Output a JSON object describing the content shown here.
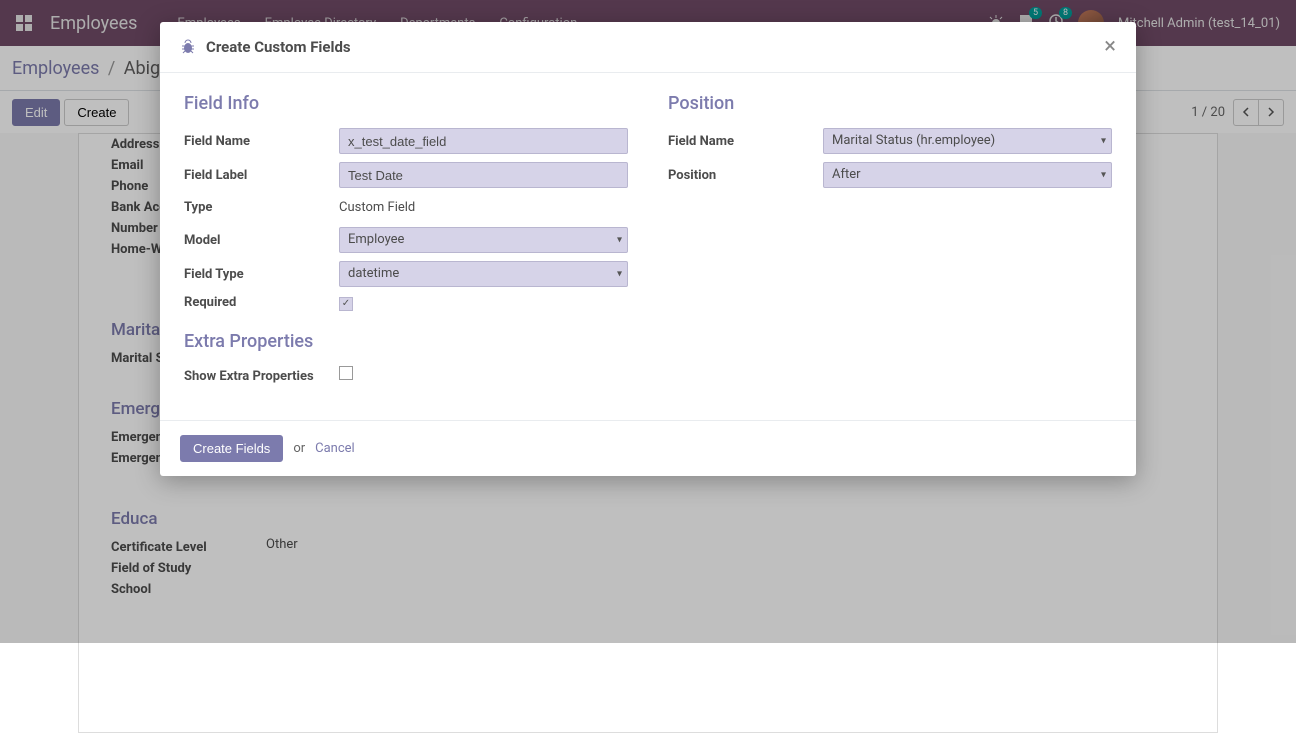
{
  "nav": {
    "brand": "Employees",
    "menu": [
      "Employees",
      "Employee Directory",
      "Departments",
      "Configuration"
    ],
    "badge1": "5",
    "badge2": "8",
    "user": "Mitchell Admin (test_14_01)"
  },
  "breadcrumb": {
    "root": "Employees",
    "current": "Abiga"
  },
  "controls": {
    "edit": "Edit",
    "create": "Create",
    "pager": "1 / 20"
  },
  "bg": {
    "labels": {
      "address": "Address",
      "email": "Email",
      "phone": "Phone",
      "bank": "Bank Acc",
      "number": "Number",
      "homework": "Home-Wo",
      "marital_h": "Marita",
      "marital_s": "Marital S",
      "emerg_h": "Emergen",
      "emerg1": "Emergen",
      "emerg2": "Emergen",
      "educ_h": "Educa",
      "cert": "Certificate Level",
      "field": "Field of Study",
      "school": "School"
    },
    "vals": {
      "cert": "Other"
    }
  },
  "modal": {
    "title": "Create Custom Fields",
    "field_info_h": "Field Info",
    "position_h": "Position",
    "extra_h": "Extra Properties",
    "labels": {
      "field_name": "Field Name",
      "field_label": "Field Label",
      "type": "Type",
      "model": "Model",
      "field_type": "Field Type",
      "required": "Required",
      "pos_field_name": "Field Name",
      "position": "Position",
      "show_extra": "Show Extra Properties"
    },
    "values": {
      "field_name": "x_test_date_field",
      "field_label": "Test Date",
      "type": "Custom Field",
      "model": "Employee",
      "field_type": "datetime",
      "pos_field_name": "Marital Status (hr.employee)",
      "position": "After"
    },
    "footer": {
      "create": "Create Fields",
      "or": "or",
      "cancel": "Cancel"
    }
  }
}
